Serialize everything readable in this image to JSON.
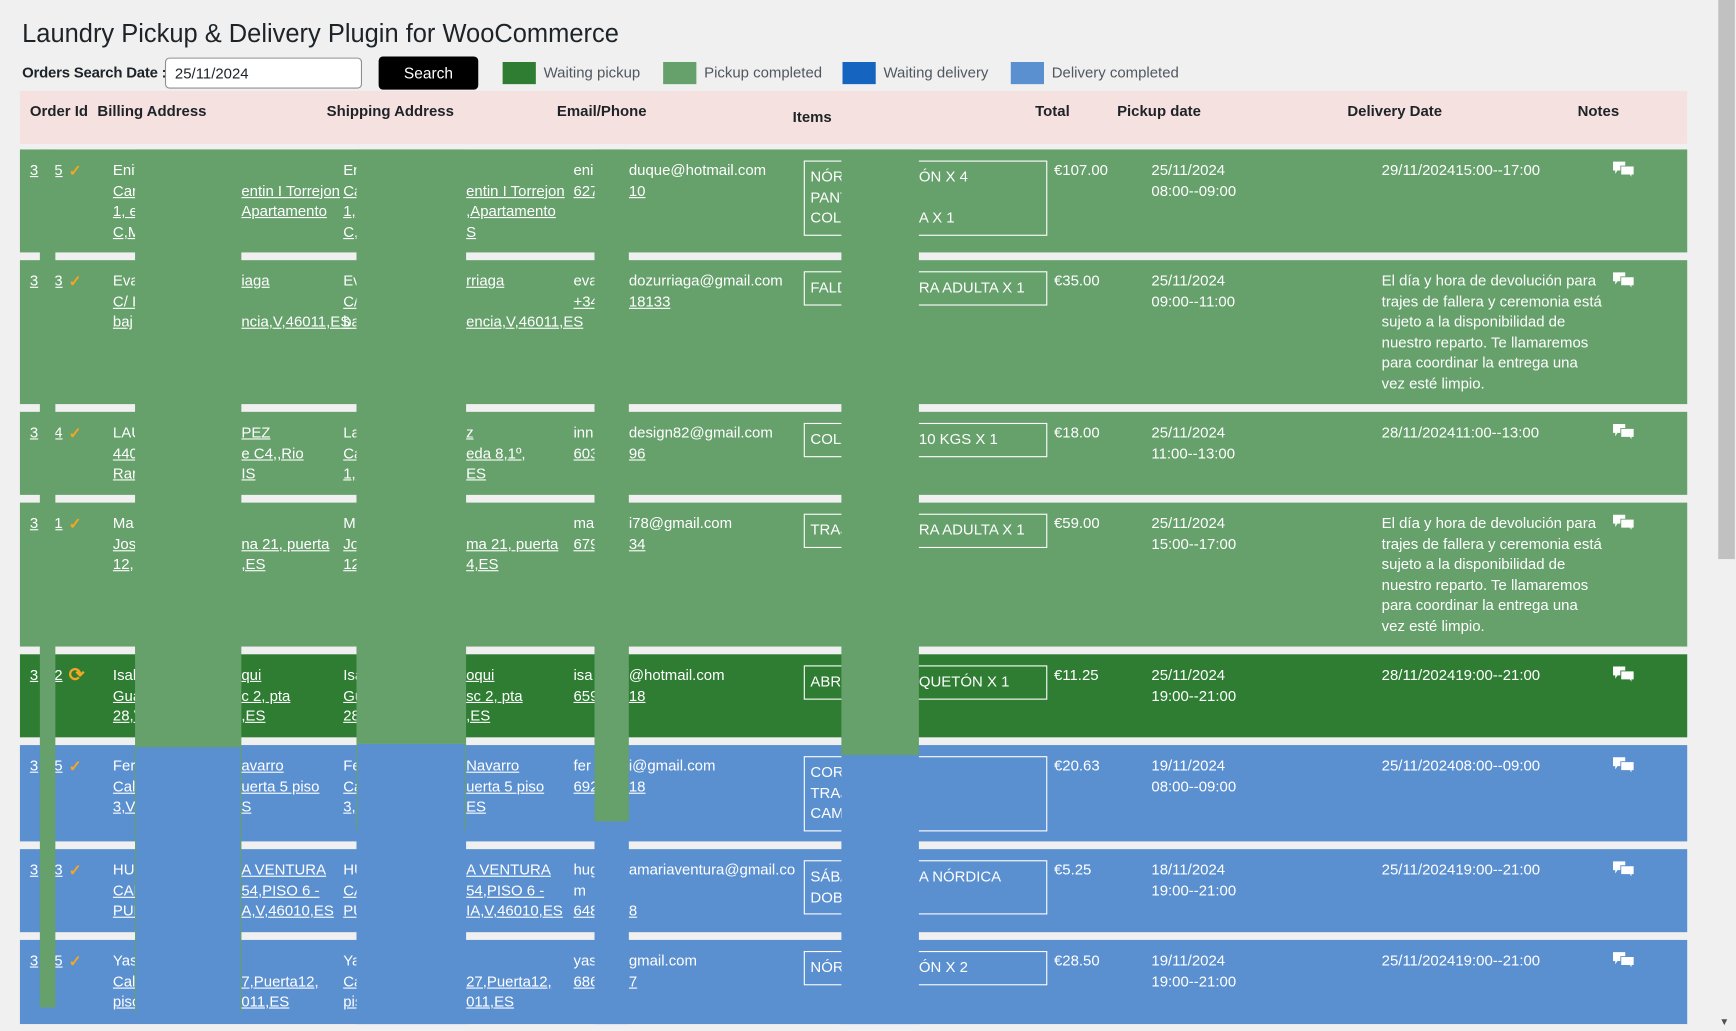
{
  "title": "Laundry Pickup & Delivery Plugin for WooCommerce",
  "search": {
    "label": "Orders Search Date :",
    "value": "25/11/2024",
    "button": "Search"
  },
  "legend": [
    {
      "label": "Waiting pickup",
      "color": "#2e7d32"
    },
    {
      "label": "Pickup completed",
      "color": "#66a06b"
    },
    {
      "label": "Waiting delivery",
      "color": "#1565c0"
    },
    {
      "label": "Delivery completed",
      "color": "#5a8fd0"
    }
  ],
  "columns": [
    "Order Id",
    "Billing Address",
    "Shipping Address",
    "Email/Phone",
    "Items",
    "Total",
    "Pickup date",
    "Delivery Date",
    "Notes"
  ],
  "note_long": "El día y hora de devolución para trajes de fallera y ceremonia está sujeto a la disponibilidad de nuestro reparto. Te llamaremos para coordinar la entrega una vez esté limpio.",
  "orders": [
    {
      "status": "Pickup completed",
      "id_a": "3",
      "id_b": "5",
      "icon": "check-icon",
      "billing": [
        "Enif' '",
        "Car",
        "1, e",
        "C,M"
      ],
      "billing_r": [
        "",
        "entin I Torrejon",
        "Apartamento",
        ""
      ],
      "shipping": [
        "Er",
        "Ca",
        "1,",
        "C,"
      ],
      "shipping_r": [
        "",
        "entin I Torrejon",
        ",Apartamento",
        "S"
      ],
      "email": [
        "eni",
        "627"
      ],
      "email_r": [
        "duque@hotmail.com",
        "10"
      ],
      "items": [
        "NÓR",
        "PANT",
        "COLC"
      ],
      "items_r": [
        "ÓN X 4",
        "",
        "A X 1"
      ],
      "total": "€107.00",
      "pickup": [
        "25/11/2024",
        "08:00--09:00"
      ],
      "delivery": "29/11/202415:00--17:00",
      "note": ""
    },
    {
      "status": "Pickup completed",
      "id_a": "3",
      "id_b": "3",
      "icon": "check-icon",
      "billing": [
        "Eva",
        "C/ I",
        "baj"
      ],
      "billing_r": [
        "iaga",
        "",
        "ncia,V,46011,ES"
      ],
      "shipping": [
        "Ev",
        "C/",
        "ba"
      ],
      "shipping_r": [
        "rriaga",
        "",
        "encia,V,46011,ES"
      ],
      "email": [
        "eva",
        "+34"
      ],
      "email_r": [
        "dozurriaga@gmail.com",
        "18133"
      ],
      "items": [
        "FALD"
      ],
      "items_r": [
        "RA ADULTA X 1"
      ],
      "total": "€35.00",
      "pickup": [
        "25/11/2024",
        "09:00--11:00"
      ],
      "delivery": "",
      "note": "El día y hora de devolución para trajes de fallera y ceremonia está sujeto a la disponibilidad de nuestro reparto. Te llamaremos para coordinar la entrega una vez esté limpio."
    },
    {
      "status": "Pickup completed",
      "id_a": "3",
      "id_b": "4",
      "icon": "check-icon",
      "billing": [
        "LAU",
        "440",
        "Rar"
      ],
      "billing_r": [
        "PEZ",
        "e C4,,Rio",
        "IS"
      ],
      "shipping": [
        "La",
        "Ca",
        "1,"
      ],
      "shipping_r": [
        "z",
        "eda 8,1º,",
        "ES"
      ],
      "email": [
        "inn",
        "603"
      ],
      "email_r": [
        "design82@gmail.com",
        "96"
      ],
      "items": [
        "COLA"
      ],
      "items_r": [
        "10 KGS X 1"
      ],
      "total": "€18.00",
      "pickup": [
        "25/11/2024",
        "11:00--13:00"
      ],
      "delivery": "28/11/202411:00--13:00",
      "note": ""
    },
    {
      "status": "Pickup completed",
      "id_a": "3",
      "id_b": "1",
      "icon": "check-icon",
      "billing": [
        "Ma",
        "Jose",
        "12,,"
      ],
      "billing_r": [
        "",
        "na 21, puerta",
        ",ES"
      ],
      "shipping": [
        "M",
        "Jo",
        "12"
      ],
      "shipping_r": [
        "",
        "ma 21, puerta",
        "4,ES"
      ],
      "email": [
        "ma",
        "679"
      ],
      "email_r": [
        "i78@gmail.com",
        "34"
      ],
      "items": [
        "TRAJ"
      ],
      "items_r": [
        "RA ADULTA X 1"
      ],
      "total": "€59.00",
      "pickup": [
        "25/11/2024",
        "15:00--17:00"
      ],
      "delivery": "",
      "note": "El día y hora de devolución para trajes de fallera y ceremonia está sujeto a la disponibilidad de nuestro reparto. Te llamaremos para coordinar la entrega una vez esté limpio."
    },
    {
      "status": "Waiting pickup",
      "id_a": "3",
      "id_b": "2",
      "icon": "sync-icon",
      "billing": [
        "Isab",
        "Gua",
        "28,V"
      ],
      "billing_r": [
        "qui",
        "c 2, pta",
        ",ES"
      ],
      "shipping": [
        "Isa",
        "Gu",
        "28"
      ],
      "shipping_r": [
        "oqui",
        "sc 2, pta",
        ",ES"
      ],
      "email": [
        "isa",
        "659"
      ],
      "email_r": [
        "@hotmail.com",
        "18"
      ],
      "items": [
        "ABRI"
      ],
      "items_r": [
        "QUETÓN X 1"
      ],
      "total": "€11.25",
      "pickup": [
        "25/11/2024",
        "19:00--21:00"
      ],
      "delivery": "28/11/202419:00--21:00",
      "note": ""
    },
    {
      "status": "Delivery completed",
      "id_a": "3",
      "id_b": "5",
      "icon": "check-icon",
      "billing": [
        "Fer",
        "Call",
        "3,Va"
      ],
      "billing_r": [
        "avarro",
        "uerta 5 piso",
        "S"
      ],
      "shipping": [
        "Fe",
        "Ca",
        "3,"
      ],
      "shipping_r": [
        "Navarro",
        "uerta 5 piso",
        "ES"
      ],
      "email": [
        "fer",
        "692"
      ],
      "email_r": [
        "i@gmail.com",
        "18"
      ],
      "items": [
        "CORI",
        "TRAJ",
        "CAM"
      ],
      "items_r": [],
      "total": "€20.63",
      "pickup": [
        "19/11/2024",
        "08:00--09:00"
      ],
      "delivery": "25/11/202408:00--09:00",
      "note": ""
    },
    {
      "status": "Delivery completed",
      "id_a": "3",
      "id_b": "3",
      "icon": "check-icon",
      "billing": [
        "HUG",
        "CAL",
        "PUE"
      ],
      "billing_r": [
        "A VENTURA",
        "54,PISO 6 -",
        "A,V,46010,ES"
      ],
      "shipping": [
        "HU",
        "CA",
        "PU"
      ],
      "shipping_r": [
        "A VENTURA",
        "54,PISO 6 -",
        "IA,V,46010,ES"
      ],
      "email": [
        "hug",
        "m",
        "648"
      ],
      "email_r": [
        "amariaventura@gmail.co",
        "",
        "8"
      ],
      "items": [
        "SÁBA",
        "DOBI"
      ],
      "items_r": [
        "A NÓRDICA"
      ],
      "total": "€5.25",
      "pickup": [
        "18/11/2024",
        "19:00--21:00"
      ],
      "delivery": "25/11/202419:00--21:00",
      "note": ""
    },
    {
      "status": "Delivery completed",
      "id_a": "3",
      "id_b": "5",
      "icon": "check-icon",
      "billing": [
        "Yas",
        "Call",
        "pisc"
      ],
      "billing_r": [
        "",
        "7,Puerta12,",
        "011,ES"
      ],
      "shipping": [
        "Yas",
        "Cal",
        "pis"
      ],
      "shipping_r": [
        "",
        "27,Puerta12,",
        "011,ES"
      ],
      "email": [
        "yas",
        "686"
      ],
      "email_r": [
        "gmail.com",
        "7"
      ],
      "items": [
        "NÓR"
      ],
      "items_r": [
        "ÓN X 2"
      ],
      "total": "€28.50",
      "pickup": [
        "19/11/2024",
        "19:00--21:00"
      ],
      "delivery": "25/11/202419:00--21:00",
      "note": ""
    }
  ]
}
